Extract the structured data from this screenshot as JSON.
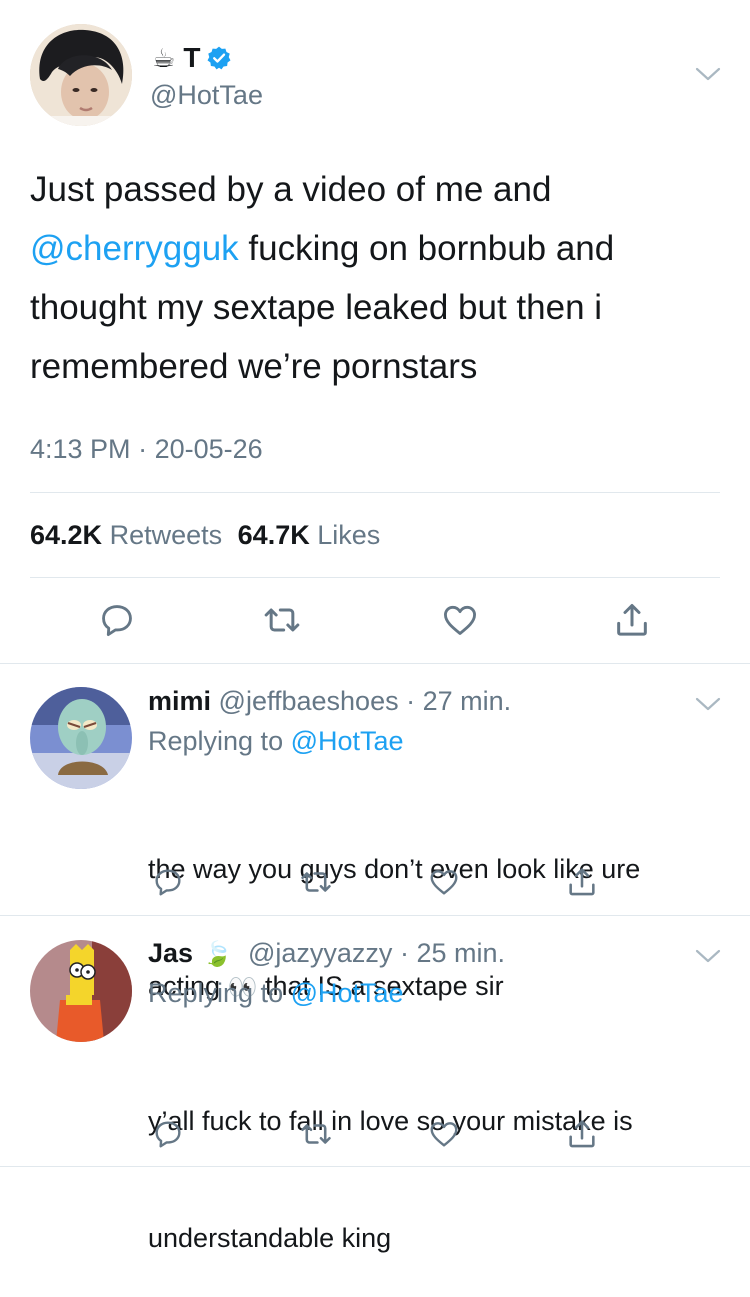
{
  "main_tweet": {
    "display_name_emoji": "☕",
    "display_name": "T",
    "handle": "@HotTae",
    "text_line1": "Just passed by a video of me and",
    "mention": "@cherrygguk",
    "text_line2_rest": " fucking on bornbub and",
    "text_line3": "thought my sextape leaked but then i",
    "text_line4": "remembered we’re pornstars",
    "time": "4:13 PM",
    "date_sep": " · ",
    "date": "20-05-26",
    "retweets_count": "64.2K",
    "retweets_label": "Retweets",
    "likes_count": "64.7K",
    "likes_label": "Likes"
  },
  "replies": [
    {
      "name": "mimi",
      "handle": "@jeffbaeshoes",
      "sep": " · ",
      "time": "27 min.",
      "replying_prefix": "Replying to ",
      "replying_handle": "@HotTae",
      "line1": "the way you guys don’t even look like ure",
      "line2a": "acting ",
      "emoji": "👀",
      "line2b": " that IS a sextape sir"
    },
    {
      "name": "Jas",
      "name_emoji": "🍃",
      "handle": "@jazyyazzy",
      "sep": " · ",
      "time": "25 min.",
      "replying_prefix": "Replying to ",
      "replying_handle": "@HotTae",
      "line1": "y’all fuck to fall in love so your mistake is",
      "line2": "understandable king"
    }
  ],
  "colors": {
    "accent": "#1da1f2",
    "muted": "#657786",
    "divider": "#e1e8ed"
  }
}
